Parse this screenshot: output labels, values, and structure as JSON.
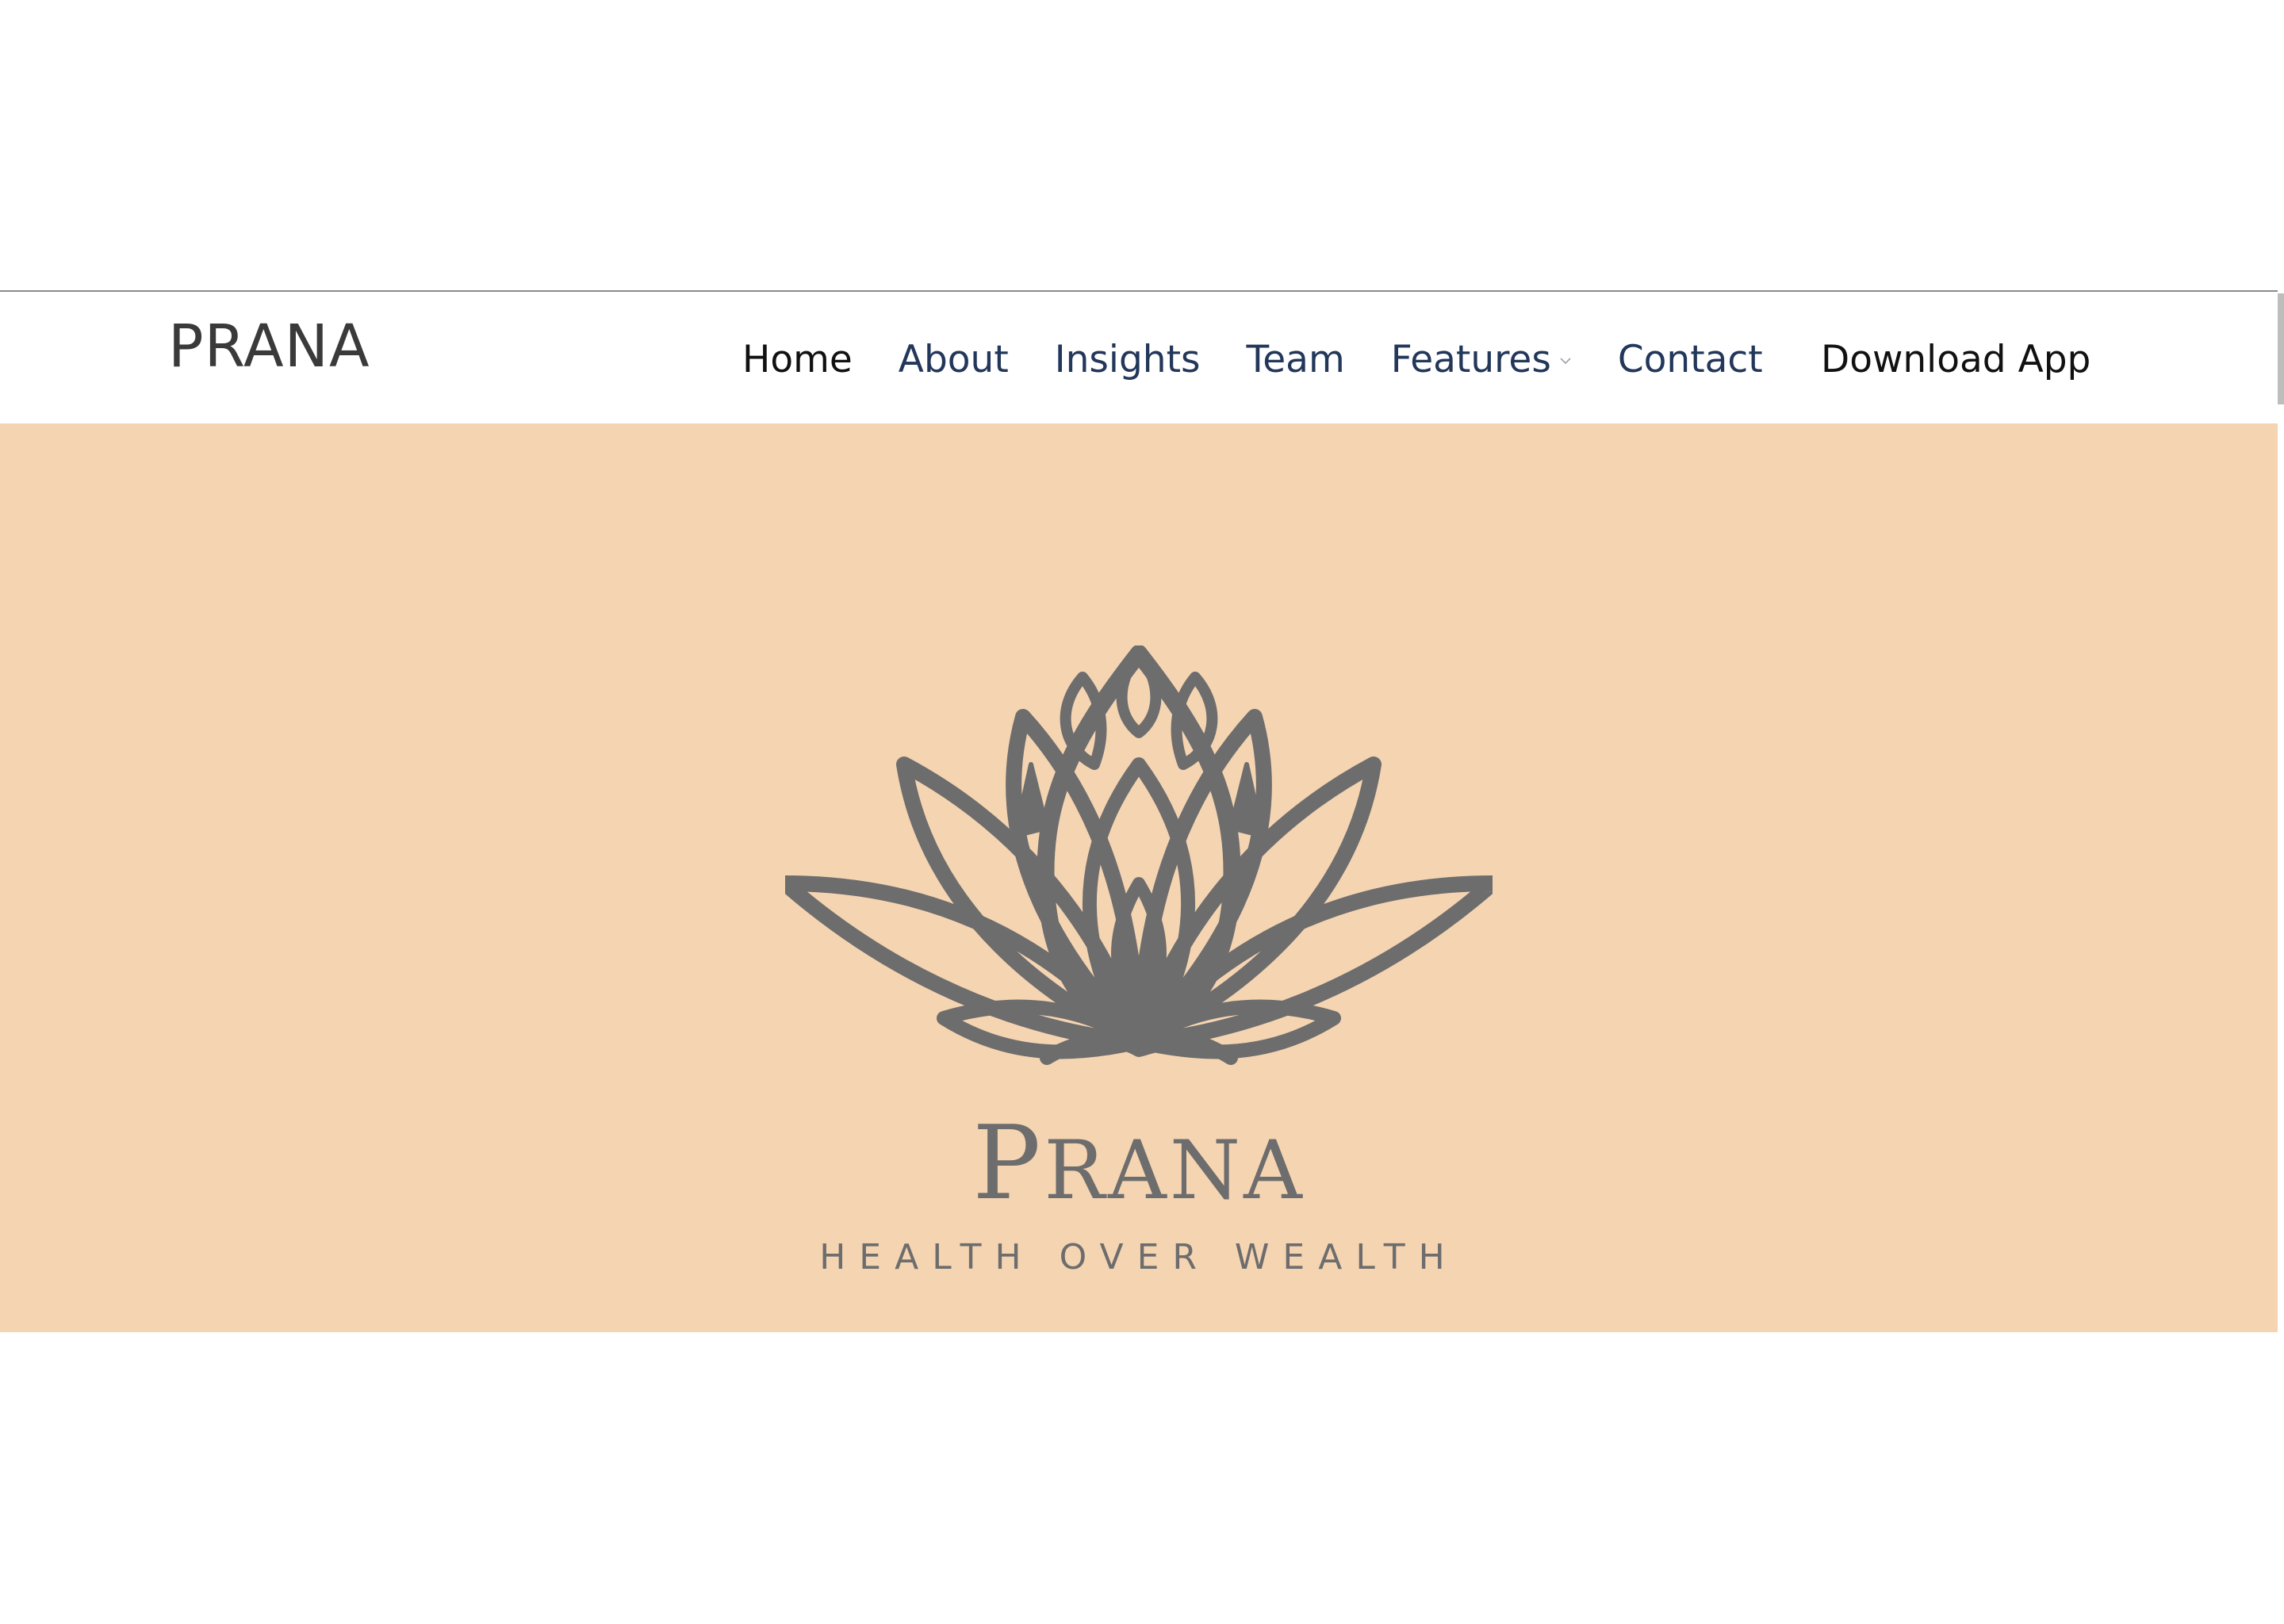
{
  "header": {
    "brand": "PRANA",
    "nav": [
      {
        "label": "Home",
        "active": true
      },
      {
        "label": "About",
        "active": false
      },
      {
        "label": "Insights",
        "active": false
      },
      {
        "label": "Team",
        "active": false
      },
      {
        "label": "Features",
        "active": false,
        "has_dropdown": true,
        "icon": "chevron-down-icon"
      },
      {
        "label": "Contact",
        "active": false
      }
    ],
    "download_label": "Download App"
  },
  "hero": {
    "logo_icon": "lotus-icon",
    "title_first": "P",
    "title_rest": "RANA",
    "tagline": "HEALTH OVER WEALTH"
  },
  "colors": {
    "hero_background": "#f5d4b2",
    "logo_gray": "#6d6d6d",
    "nav_link": "#22375a",
    "nav_active": "#111111",
    "brand_text": "#3a3a3a"
  }
}
